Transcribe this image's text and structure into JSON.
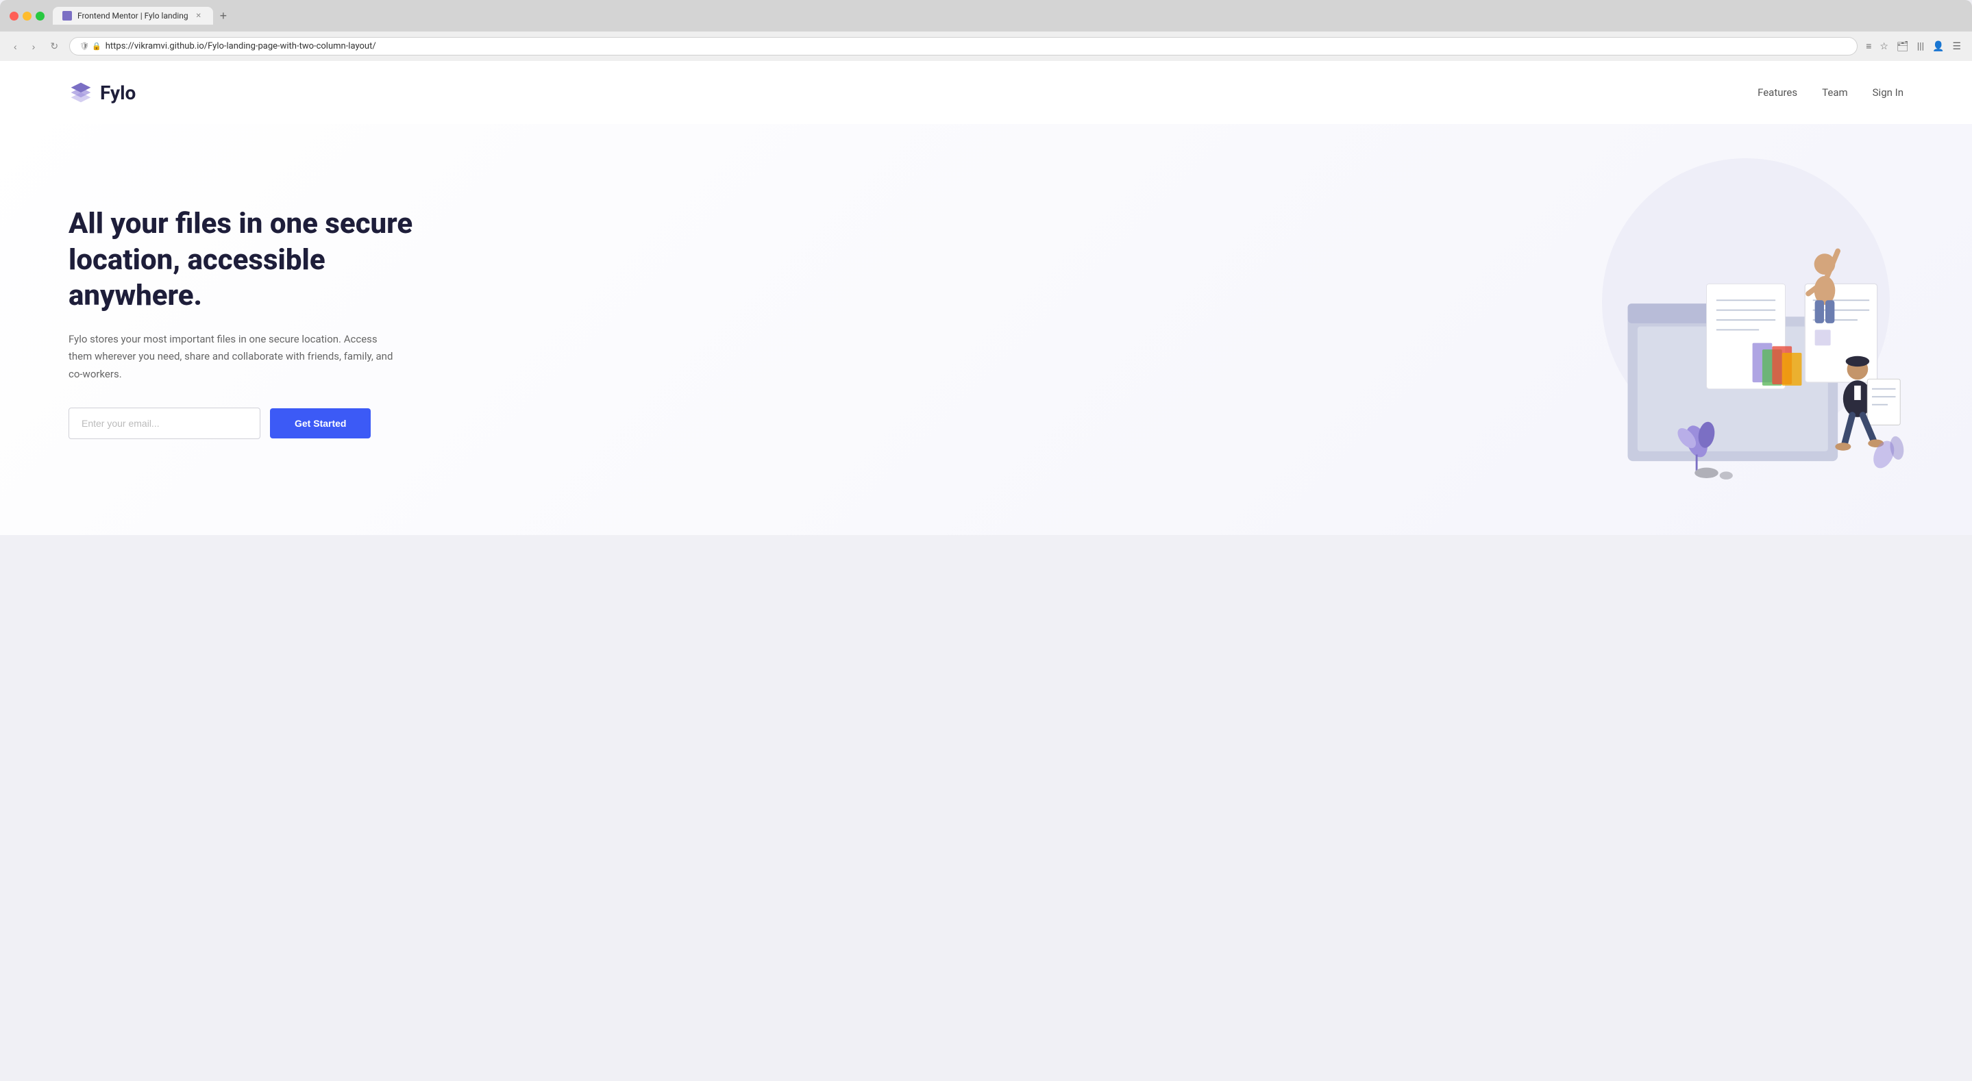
{
  "browser": {
    "tab_title": "Frontend Mentor | Fylo landing",
    "url": "https://vikramvi.github.io/Fylo-landing-page-with-two-column-layout/",
    "new_tab_label": "+",
    "nav": {
      "back": "‹",
      "forward": "›",
      "reload": "↻"
    }
  },
  "site": {
    "logo_text": "Fylo",
    "nav": {
      "features": "Features",
      "team": "Team",
      "signin": "Sign In"
    },
    "hero": {
      "title": "All your files in one secure location, accessible anywhere.",
      "description": "Fylo stores your most important files in one secure location. Access them wherever you need, share and collaborate with friends, family, and co-workers.",
      "email_placeholder": "Enter your email...",
      "cta_label": "Get Started"
    }
  },
  "colors": {
    "accent": "#3c5af6",
    "text_dark": "#1e1e3a",
    "text_muted": "#666666",
    "logo_purple": "#7b6fc4"
  }
}
